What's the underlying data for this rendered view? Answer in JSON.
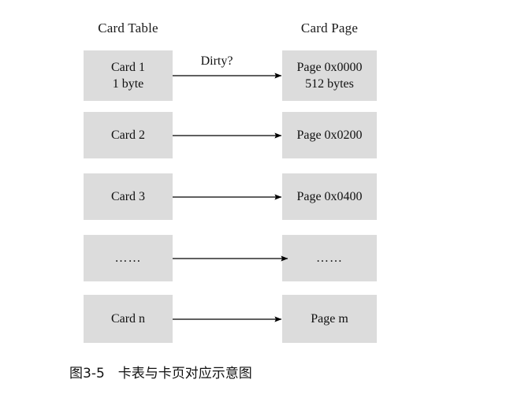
{
  "figure": {
    "caption": "图3-5　卡表与卡页对应示意图",
    "background_color": "#ffffff",
    "box_fill_color": "#dcdcdc",
    "line_color": "#000000"
  },
  "columns": {
    "left_header": "Card Table",
    "right_header": "Card Page"
  },
  "rows": [
    {
      "left": {
        "line1": "Card 1",
        "line2": "1 byte"
      },
      "right": {
        "line1": "Page 0x0000",
        "line2": "512 bytes"
      },
      "edge_label": "Dirty?"
    },
    {
      "left": {
        "line1": "Card 2",
        "line2": ""
      },
      "right": {
        "line1": "Page 0x0200",
        "line2": ""
      },
      "edge_label": ""
    },
    {
      "left": {
        "line1": "Card 3",
        "line2": ""
      },
      "right": {
        "line1": "Page 0x0400",
        "line2": ""
      },
      "edge_label": ""
    },
    {
      "left": {
        "line1": "……",
        "line2": ""
      },
      "right": {
        "line1": "……",
        "line2": ""
      },
      "edge_label": ""
    },
    {
      "left": {
        "line1": "Card n",
        "line2": ""
      },
      "right": {
        "line1": "Page m",
        "line2": ""
      },
      "edge_label": ""
    }
  ]
}
